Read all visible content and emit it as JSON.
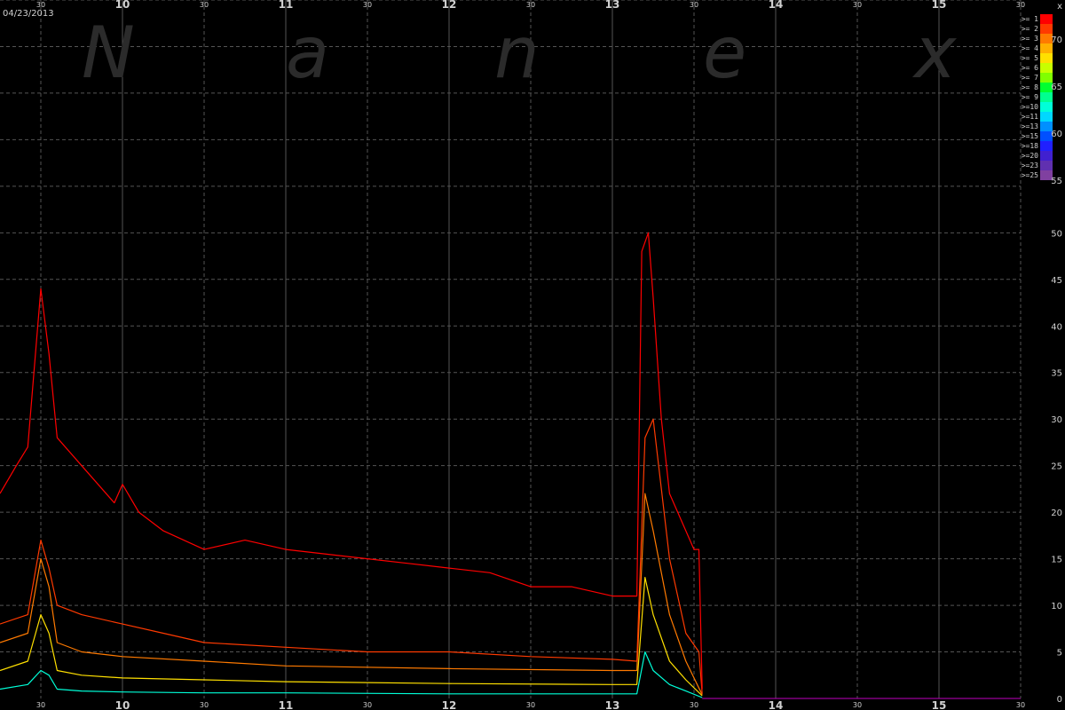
{
  "date": "04/23/2013",
  "watermark": [
    "N",
    "a",
    "n",
    "e",
    "x"
  ],
  "axis_right_label": "x",
  "legend_labels": [
    ">= 1",
    ">= 2",
    ">= 3",
    ">= 4",
    ">= 5",
    ">= 6",
    ">= 7",
    ">= 8",
    ">= 9",
    ">=10",
    ">=11",
    ">=13",
    ">=15",
    ">=18",
    ">=20",
    ">=23",
    ">=25"
  ],
  "legend_scale_ticks": [
    "70",
    "65",
    "60",
    "55"
  ],
  "colors": {
    "background": "#000000",
    "grid": "#555555",
    "text": "#d0d0d0",
    "legend": [
      "#ff0000",
      "#ff3a00",
      "#ff7a00",
      "#ffb000",
      "#ffe000",
      "#c8ff00",
      "#80ff00",
      "#00ff30",
      "#00ff90",
      "#00ffd8",
      "#00d8ff",
      "#0090ff",
      "#0050ff",
      "#2020ff",
      "#4020d0",
      "#6030b0",
      "#8040a0"
    ]
  },
  "chart_data": {
    "type": "line",
    "x_axis": {
      "major_ticks": [
        "10",
        "11",
        "12",
        "13",
        "14",
        "15"
      ],
      "minor_ticks": [
        "30",
        "30",
        "30",
        "30",
        "30",
        "30",
        "30"
      ],
      "xlim": [
        9.25,
        15.5
      ]
    },
    "y_axis": {
      "ticks": [
        "0",
        "5",
        "10",
        "15",
        "20",
        "25",
        "30",
        "35",
        "40",
        "45",
        "50"
      ],
      "ylim": [
        0,
        75
      ]
    },
    "grid": true,
    "legend": "top-right",
    "series": [
      {
        "name": ">= 1",
        "x": [
          9.25,
          9.35,
          9.42,
          9.5,
          9.55,
          9.6,
          9.75,
          9.95,
          10.0,
          10.1,
          10.25,
          10.5,
          10.75,
          11.0,
          11.25,
          11.5,
          11.75,
          12.0,
          12.25,
          12.5,
          12.75,
          13.0,
          13.1,
          13.15,
          13.18,
          13.22,
          13.25,
          13.3,
          13.35,
          13.4,
          13.45,
          13.5,
          13.53,
          13.55
        ],
        "values": [
          22,
          25,
          27,
          44,
          37,
          28,
          25,
          21,
          23,
          20,
          18,
          16,
          17,
          16,
          15.5,
          15,
          14.5,
          14,
          13.5,
          12,
          12,
          11,
          11,
          11,
          48,
          50,
          43,
          30,
          22,
          20,
          18,
          16,
          16,
          1
        ]
      },
      {
        "name": ">= 2",
        "x": [
          9.25,
          9.42,
          9.5,
          9.55,
          9.6,
          9.75,
          10.0,
          10.25,
          10.5,
          11.0,
          11.5,
          12.0,
          12.5,
          13.0,
          13.15,
          13.2,
          13.25,
          13.35,
          13.45,
          13.53,
          13.55
        ],
        "values": [
          8,
          9,
          17,
          14,
          10,
          9,
          8,
          7,
          6,
          5.5,
          5,
          5,
          4.5,
          4.2,
          4,
          28,
          30,
          15,
          7,
          5,
          0.5
        ]
      },
      {
        "name": ">= 3",
        "x": [
          9.25,
          9.42,
          9.5,
          9.55,
          9.6,
          9.75,
          10.0,
          10.5,
          11.0,
          12.0,
          13.0,
          13.15,
          13.2,
          13.25,
          13.35,
          13.45,
          13.55
        ],
        "values": [
          6,
          7,
          15,
          12,
          6,
          5,
          4.5,
          4,
          3.5,
          3.2,
          3,
          3,
          22,
          18,
          9,
          4,
          0.4
        ]
      },
      {
        "name": ">= 5",
        "x": [
          9.25,
          9.42,
          9.5,
          9.55,
          9.6,
          9.75,
          10.0,
          10.5,
          11.0,
          12.0,
          13.0,
          13.15,
          13.2,
          13.25,
          13.35,
          13.45,
          13.55
        ],
        "values": [
          3,
          4,
          9,
          7,
          3,
          2.5,
          2.2,
          2,
          1.8,
          1.6,
          1.5,
          1.5,
          13,
          9,
          4,
          2,
          0.3
        ]
      },
      {
        "name": ">= 10",
        "x": [
          9.25,
          9.42,
          9.5,
          9.55,
          9.6,
          9.75,
          10.0,
          10.5,
          11.0,
          12.0,
          13.0,
          13.15,
          13.2,
          13.25,
          13.35,
          13.45,
          13.55
        ],
        "values": [
          1,
          1.5,
          3,
          2.5,
          1,
          0.8,
          0.7,
          0.6,
          0.6,
          0.5,
          0.5,
          0.5,
          5,
          3,
          1.5,
          0.8,
          0.1
        ]
      }
    ]
  }
}
